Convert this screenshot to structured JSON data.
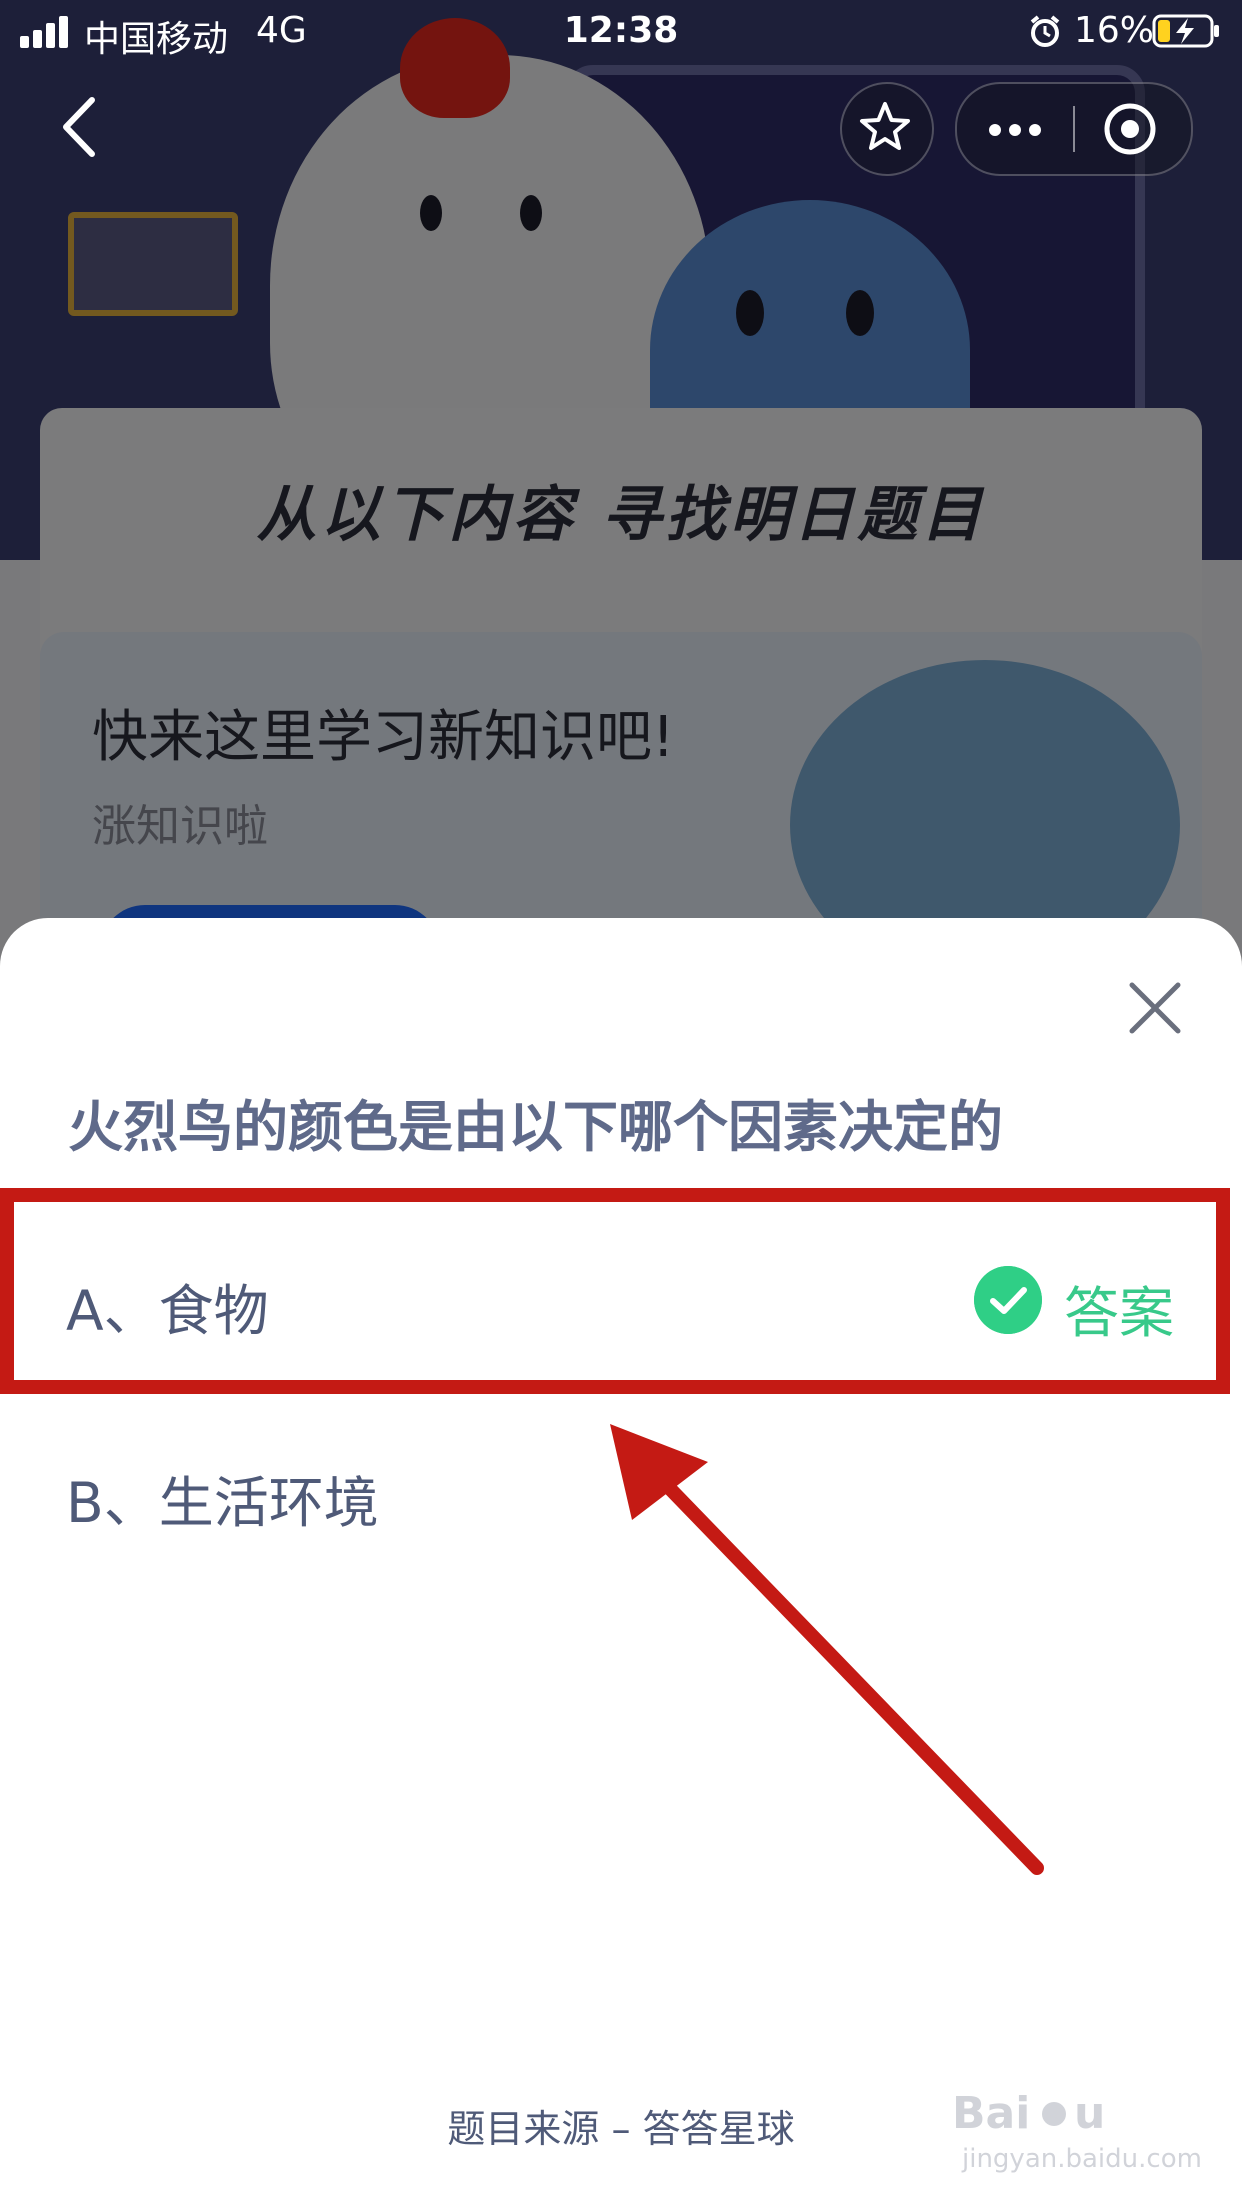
{
  "status_bar": {
    "carrier": "中国移动",
    "network": "4G",
    "time": "12:38",
    "battery": "16%",
    "alarm_icon": "alarm-clock-icon",
    "battery_icon": "battery-charging-icon"
  },
  "nav": {
    "back_icon": "chevron-left-icon",
    "favorite_icon": "star-icon",
    "more_icon": "more-dots-icon",
    "exit_icon": "target-circle-icon"
  },
  "background": {
    "headline": "从以下内容 寻找明日题目",
    "card_title": "快来这里学习新知识吧!",
    "card_subtitle": "涨知识啦"
  },
  "quiz": {
    "question": "火烈鸟的颜色是由以下哪个因素决定的",
    "options": [
      {
        "label": "A、食物",
        "is_answer": true
      },
      {
        "label": "B、生活环境",
        "is_answer": false
      }
    ],
    "answer_label": "答案",
    "source": "题目来源 – 答答星球"
  },
  "watermark": {
    "text": "jingyan.baidu.com"
  },
  "colors": {
    "answer_green": "#38c98a",
    "highlight_red": "#c41a14",
    "question_text": "#5f6a8a"
  }
}
